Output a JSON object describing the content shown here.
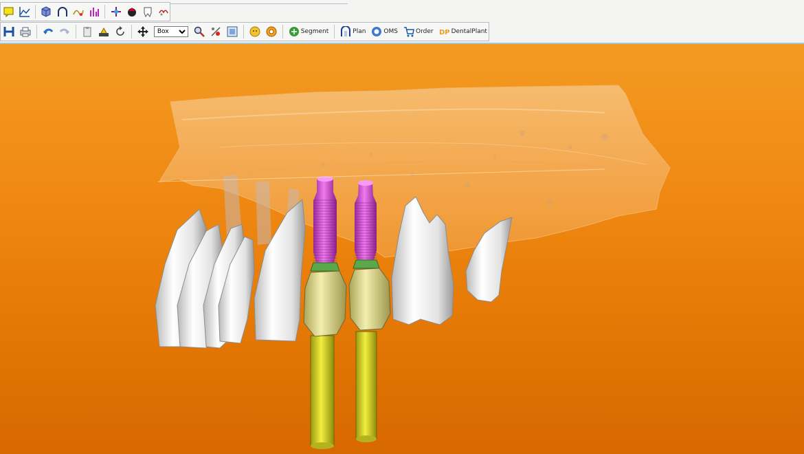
{
  "toolbar": {
    "row2": {
      "view_select": {
        "selected": "Box",
        "options": [
          "Box"
        ]
      },
      "segment_label": "Segment",
      "plan_label": "Plan",
      "oms_label": "OMS",
      "order_label": "Order",
      "dentalplant_label": "DentalPlant"
    },
    "icons_row1": [
      "note-icon",
      "graph-icon",
      "cube-icon",
      "arch-icon",
      "curve-tool-icon",
      "bar-tool-icon",
      "move-cross-icon",
      "sphere-icon",
      "tooth-outline-icon",
      "tooth-tool-icon"
    ],
    "icons_row2": [
      "floppy-save-icon",
      "print-icon",
      "undo-icon",
      "redo-icon",
      "clipboard-icon",
      "render-icon",
      "rotate-icon",
      "pan-icon",
      "zoom-icon",
      "measure-icon",
      "fit-view-icon",
      "face-icon",
      "target-icon",
      "segment-icon",
      "plan-icon",
      "oms-icon",
      "order-icon",
      "dentalplant-icon"
    ]
  },
  "viewport": {
    "background_colors": [
      "#f39a22",
      "#d86800"
    ],
    "implant_color": "#d640d6",
    "crown_color": "#e3dc8c",
    "abutment_color": "#5aa84a",
    "guide_post_color": "#e6e030",
    "tooth_color": "#f2f2f2",
    "bone_color": "#f6c07a"
  }
}
